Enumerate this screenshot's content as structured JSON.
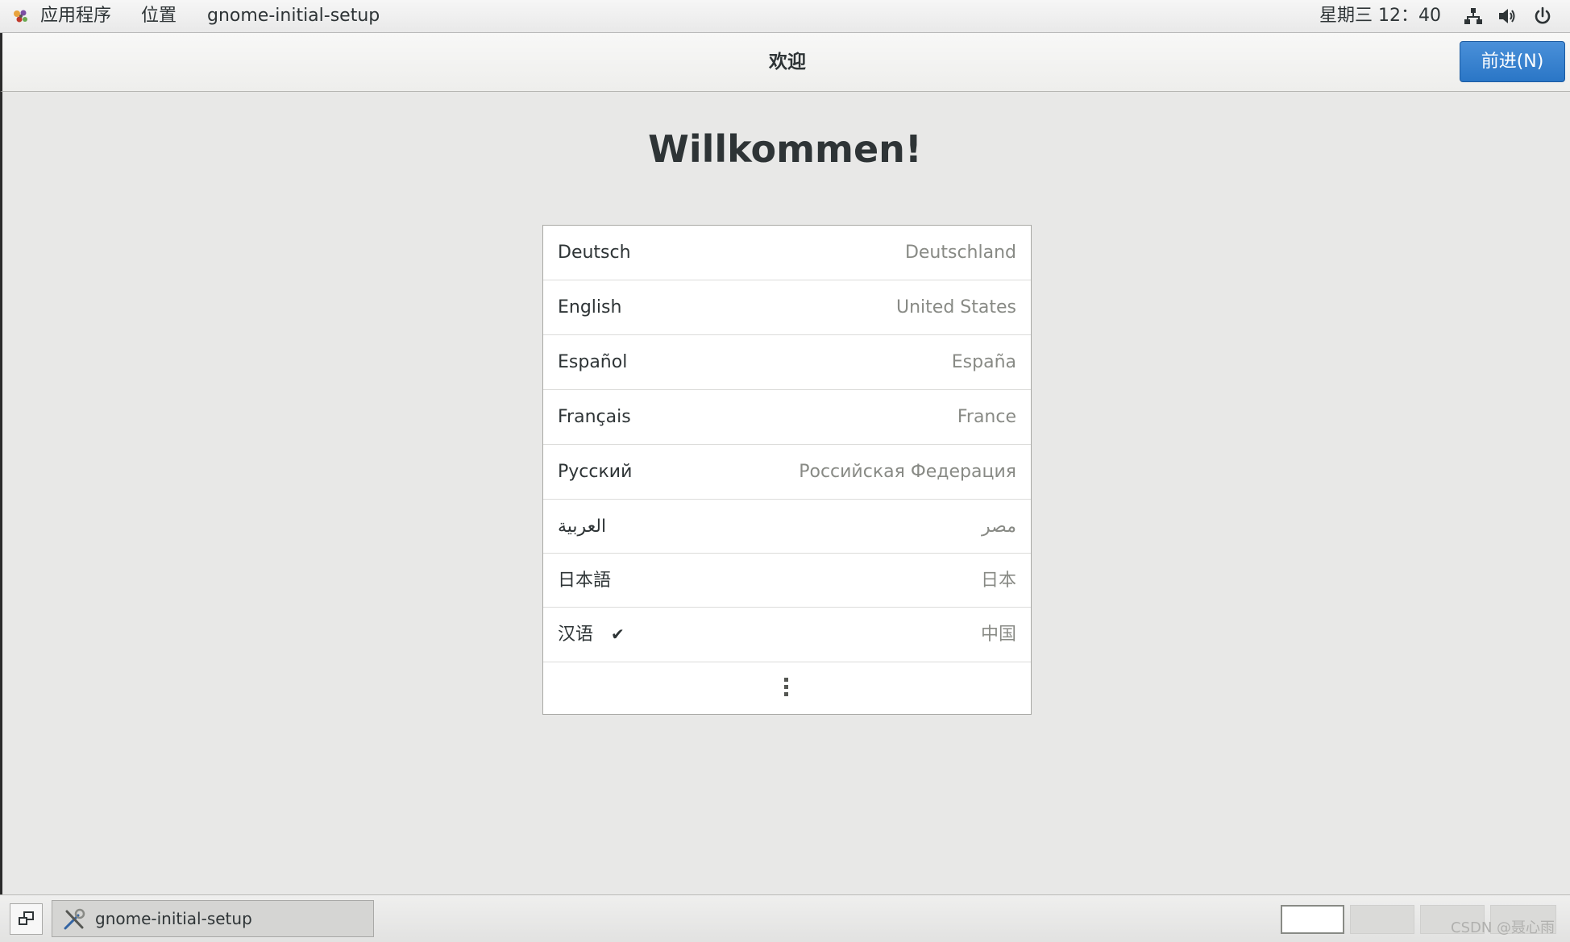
{
  "top_panel": {
    "apps_label": "应用程序",
    "places_label": "位置",
    "window_title": "gnome-initial-setup",
    "clock": "星期三 12：40"
  },
  "header": {
    "title": "欢迎",
    "next_button": "前进(N)"
  },
  "main": {
    "heading": "Willkommen!",
    "languages": [
      {
        "name": "Deutsch",
        "region": "Deutschland",
        "selected": false
      },
      {
        "name": "English",
        "region": "United States",
        "selected": false
      },
      {
        "name": "Español",
        "region": "España",
        "selected": false
      },
      {
        "name": "Français",
        "region": "France",
        "selected": false
      },
      {
        "name": "Русский",
        "region": "Российская Федерация",
        "selected": false
      },
      {
        "name": "العربية",
        "region": "مصر",
        "selected": false
      },
      {
        "name": "日本語",
        "region": "日本",
        "selected": false
      },
      {
        "name": "汉语",
        "region": "中国",
        "selected": true
      }
    ],
    "check_mark": "✔"
  },
  "bottom_panel": {
    "task_label": "gnome-initial-setup"
  },
  "watermark": "CSDN @聂心雨",
  "colors": {
    "accent": "#2a76c6",
    "background": "#e8e8e7",
    "region_text": "#888a85"
  }
}
